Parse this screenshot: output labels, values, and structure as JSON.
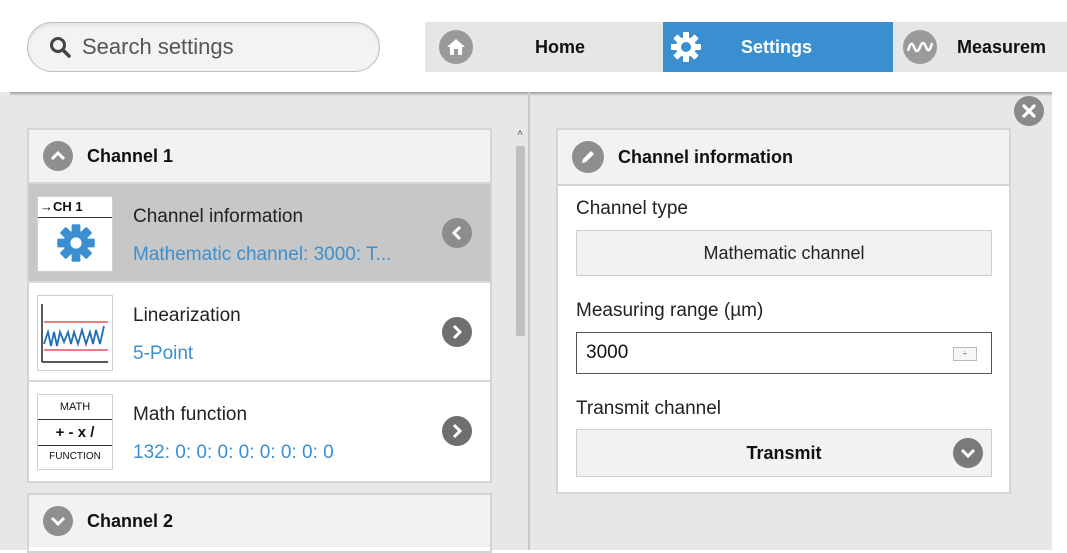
{
  "search": {
    "placeholder": "Search settings"
  },
  "nav": {
    "tabs": [
      {
        "label": "Home",
        "icon": "home-icon"
      },
      {
        "label": "Settings",
        "icon": "gear-icon",
        "active": true
      },
      {
        "label": "Measurem",
        "icon": "waveform-icon"
      }
    ]
  },
  "colors": {
    "accent": "#3a8fd1",
    "selected_row": "#c7c7c7",
    "panel_bg": "#e7e7e7"
  },
  "left": {
    "channel1": {
      "label": "Channel 1",
      "items": [
        {
          "thumb_label": "→CH 1",
          "title": "Channel information",
          "sub": "Mathematic channel: 3000: T...",
          "icon": "gear-icon"
        },
        {
          "title": "Linearization",
          "sub": "5-Point",
          "icon": "linearization-chart-icon"
        },
        {
          "thumb_top": "MATH",
          "thumb_mid": "+ - x /",
          "thumb_bottom": "FUNCTION",
          "title": "Math function",
          "sub": "132: 0: 0: 0: 0: 0: 0: 0: 0",
          "icon": "math-function-icon"
        }
      ]
    },
    "channel2": {
      "label": "Channel 2"
    }
  },
  "panel": {
    "title": "Channel information",
    "channel_type": {
      "label": "Channel type",
      "value": "Mathematic channel"
    },
    "measuring_range": {
      "label": "Measuring range (µm)",
      "value": "3000"
    },
    "transmit": {
      "label": "Transmit channel",
      "value": "Transmit"
    }
  }
}
